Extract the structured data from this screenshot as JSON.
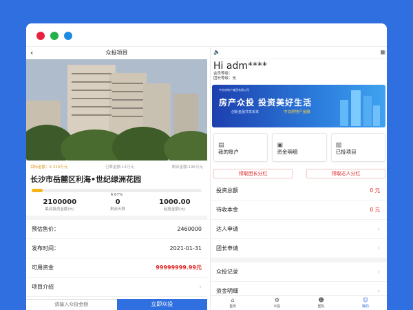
{
  "left": {
    "header_title": "众投项目",
    "back_icon": "chevron-left-icon",
    "stats": {
      "target": "目标金额：¥ 210万元",
      "invested": "已筹金额:14万元",
      "remaining": "剩余金额:196万元"
    },
    "project_title": "长沙市岳麓区利海•世纪绿洲花园",
    "progress": {
      "percent_value": 6.67,
      "label": "6.67%"
    },
    "numbers": [
      {
        "value": "2100000",
        "label": "最高投资金额(元)"
      },
      {
        "value": "0",
        "label": "剩余天数"
      },
      {
        "value": "1000.00",
        "label": "起投金额(元)"
      }
    ],
    "rows": [
      {
        "label": "预估售价：",
        "value": "2460000"
      },
      {
        "label": "发布时间：",
        "value": "2021-01-31"
      },
      {
        "label": "可用资金",
        "value": "99999999.99元"
      },
      {
        "label": "项目介绍",
        "value": ""
      }
    ],
    "footer": {
      "input_placeholder": "请输入众投金额",
      "button": "立即众投"
    }
  },
  "right": {
    "speaker_icon": "speaker-icon",
    "greeting": "Hi adm****",
    "member_level": "会员等级：",
    "leader_level": "团长等级：无",
    "banner": {
      "logo_text": "中交房地产集团有限公司",
      "title": "房产众投  投资美好生活",
      "sub1": "创新金融共享未来",
      "sub2": "中交房地产金融"
    },
    "cards": [
      {
        "icon": "user-card-icon",
        "label": "我的账户"
      },
      {
        "icon": "wallet-icon",
        "label": "资金明细"
      },
      {
        "icon": "folder-icon",
        "label": "已投项目"
      }
    ],
    "red_buttons": [
      "领取团长分红",
      "领取达人分红"
    ],
    "rows": [
      {
        "label": "投资总额",
        "value": "0 元"
      },
      {
        "label": "待收本金",
        "value": "0 元"
      },
      {
        "label": "达人申请",
        "value": ""
      },
      {
        "label": "团长申请",
        "value": ""
      },
      {
        "label": "众投记录",
        "value": ""
      },
      {
        "label": "资金明细",
        "value": ""
      }
    ],
    "tabs": [
      {
        "icon": "home-icon",
        "label": "首页"
      },
      {
        "icon": "crowdfund-icon",
        "label": "众投"
      },
      {
        "icon": "team-icon",
        "label": "团队"
      },
      {
        "icon": "profile-icon",
        "label": "我的"
      }
    ]
  },
  "colors": {
    "accent": "#2f6fe0",
    "red": "#e02020",
    "gold": "#d99a1a"
  }
}
